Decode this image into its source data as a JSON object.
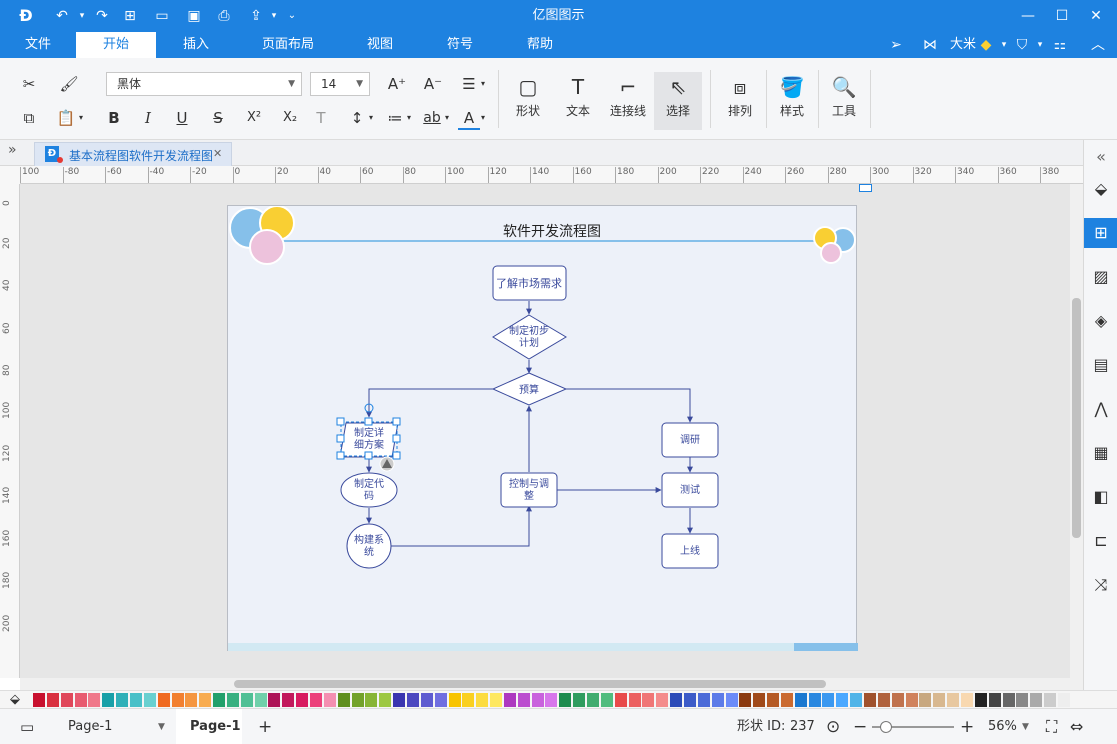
{
  "app": {
    "title": "亿图图示"
  },
  "quick_access_icons": [
    "logo-icon",
    "undo-icon",
    "redo-icon",
    "new-icon",
    "open-icon",
    "save-icon",
    "print-icon",
    "export-icon",
    "customize-icon"
  ],
  "menu": {
    "items": [
      "文件",
      "开始",
      "插入",
      "页面布局",
      "视图",
      "符号",
      "帮助"
    ],
    "active": "开始"
  },
  "user": {
    "name": "大米"
  },
  "toolbar": {
    "font_name": "黑体",
    "font_size": "14",
    "bold": "B",
    "italic": "I",
    "underline": "U",
    "strike": "S",
    "superscript": "X²",
    "subscript": "X₂",
    "shape_label": "形状",
    "text_label": "文本",
    "connector_label": "连接线",
    "select_label": "选择",
    "arrange_label": "排列",
    "style_label": "样式",
    "tools_label": "工具"
  },
  "document_tab": {
    "title": "基本流程图软件开发流程图"
  },
  "ruler": {
    "h_labels": [
      "100",
      "-80",
      "-60",
      "-40",
      "-20",
      "0",
      "20",
      "40",
      "60",
      "80",
      "100",
      "120",
      "140",
      "160",
      "180",
      "200",
      "220",
      "240",
      "260",
      "280",
      "300",
      "320",
      "340",
      "360",
      "380"
    ],
    "v_labels": [
      "0",
      "20",
      "40",
      "60",
      "80",
      "100",
      "120",
      "140",
      "160",
      "180",
      "200"
    ]
  },
  "diagram": {
    "title": "软件开发流程图",
    "nodes": {
      "research_market": "了解市场需求",
      "initial_plan": "制定初步计划",
      "budget": "预算",
      "detailed_plan": "制定详细方案",
      "write_code": "制定代码",
      "build_system": "构建系统",
      "control_adjust": "控制与调整",
      "survey": "调研",
      "test": "测试",
      "launch": "上线"
    },
    "colors": {
      "line": "#3a4a9c",
      "circle_blue": "#86c0ea",
      "circle_yellow": "#f9cf33",
      "circle_pink": "#edc2dc",
      "title_line": "#86c0ea"
    }
  },
  "right_panel_icons": [
    "collapse-icon",
    "fill-icon",
    "theme-icon",
    "image-icon",
    "layers-icon",
    "page-icon",
    "chart-icon",
    "table-icon",
    "shapes-icon",
    "outline-icon",
    "shuffle-icon"
  ],
  "palette": {
    "colors": [
      "#c8102e",
      "#d9303f",
      "#e0475a",
      "#e85b70",
      "#f0788a",
      "#18a0a8",
      "#30b0b8",
      "#48c0c8",
      "#68d0d0",
      "#f06a20",
      "#f28030",
      "#f59640",
      "#f8ac50",
      "#22a06b",
      "#38b080",
      "#50c095",
      "#70d0aa",
      "#ad1457",
      "#c2185b",
      "#d81b60",
      "#ec407a",
      "#f48fb1",
      "#5f8f1e",
      "#73a22a",
      "#88b536",
      "#9dc842",
      "#3a35b0",
      "#4c48c0",
      "#5e5bd0",
      "#706ee0",
      "#f8c400",
      "#fad020",
      "#fcdc40",
      "#fee860",
      "#ad38c0",
      "#bb4dcf",
      "#c962dd",
      "#d777eb",
      "#1e8c4e",
      "#2f9c5e",
      "#40ac6e",
      "#51bc7e",
      "#e84a4a",
      "#ec6060",
      "#f07676",
      "#f48c8c",
      "#2c4bb8",
      "#3c5bc8",
      "#4c6bd8",
      "#5c7be8",
      "#6c8bf8",
      "#8b3a0f",
      "#a04a1a",
      "#b55a25",
      "#ca6a30",
      "#1a78d0",
      "#2a88e0",
      "#3a98f0",
      "#4aa8ff",
      "#50b4e8",
      "#a0522d",
      "#b0623d",
      "#c0724d",
      "#d0825d",
      "#c8a880",
      "#d8b890",
      "#e8c8a0",
      "#f8d8b0",
      "#222222",
      "#444444",
      "#666666",
      "#888888",
      "#aaaaaa",
      "#cccccc",
      "#eeeeee"
    ]
  },
  "status": {
    "page_select": "Page-1",
    "page_tab": "Page-1",
    "add_page": "+",
    "shape_id_label": "形状 ID:",
    "shape_id_value": "237",
    "zoom_level": "56%",
    "zoom_minus": "−",
    "zoom_plus": "+"
  }
}
